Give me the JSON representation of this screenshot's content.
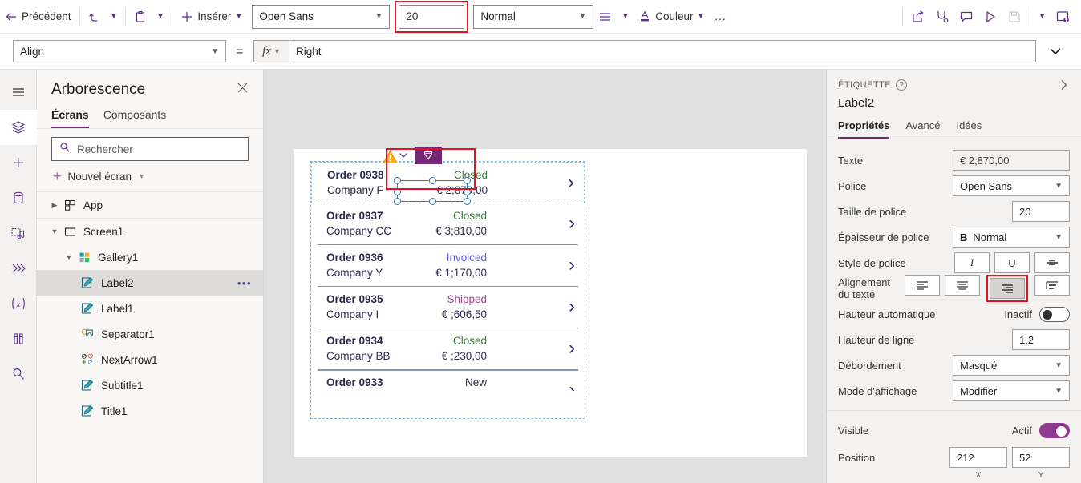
{
  "commandbar": {
    "back": "Précédent",
    "insert": "Insérer",
    "color": "Couleur",
    "more": "…",
    "font_name": "Open Sans",
    "font_size": "20",
    "font_weight": "Normal",
    "icons": {
      "back_arrow": "back-arrow-icon",
      "undo": "undo-icon",
      "paste": "paste-icon",
      "plus": "plus-icon",
      "align_lines": "align-lines-icon",
      "font_color": "font-color-icon",
      "share": "share-icon",
      "checker": "app-checker-icon",
      "comment": "comment-icon",
      "play": "play-preview-icon",
      "save": "save-icon",
      "publish": "publish-icon"
    }
  },
  "formulabar": {
    "property": "Align",
    "equals": "=",
    "fx": "fx",
    "formula": "Right"
  },
  "tree": {
    "title": "Arborescence",
    "tabs": [
      {
        "label": "Écrans",
        "selected": true
      },
      {
        "label": "Composants",
        "selected": false
      }
    ],
    "search_placeholder": "Rechercher",
    "new_screen": "Nouvel écran",
    "items": [
      {
        "label": "App",
        "indent": 0,
        "chev": "right",
        "icon": "app-grid-icon",
        "selected": false,
        "menu": false
      },
      {
        "label": "Screen1",
        "indent": 0,
        "chev": "down",
        "icon": "screen-icon",
        "selected": false,
        "menu": false
      },
      {
        "label": "Gallery1",
        "indent": 1,
        "chev": "down",
        "icon": "gallery-icon",
        "selected": false,
        "menu": false
      },
      {
        "label": "Label2",
        "indent": 2,
        "chev": "none",
        "icon": "label-icon",
        "selected": true,
        "menu": true
      },
      {
        "label": "Label1",
        "indent": 2,
        "chev": "none",
        "icon": "label-icon",
        "selected": false,
        "menu": false
      },
      {
        "label": "Separator1",
        "indent": 2,
        "chev": "none",
        "icon": "separator-icon",
        "selected": false,
        "menu": false
      },
      {
        "label": "NextArrow1",
        "indent": 2,
        "chev": "none",
        "icon": "nextarrow-icon",
        "selected": false,
        "menu": false
      },
      {
        "label": "Subtitle1",
        "indent": 2,
        "chev": "none",
        "icon": "label-icon",
        "selected": false,
        "menu": false
      },
      {
        "label": "Title1",
        "indent": 2,
        "chev": "none",
        "icon": "label-icon",
        "selected": false,
        "menu": false
      }
    ]
  },
  "canvas": {
    "gallery_rows": [
      {
        "title": "Order 0938",
        "company": "Company F",
        "status": "Closed",
        "status_color": "#3a7a3a",
        "amount": "€ 2;870,00",
        "selected": true,
        "divider": false,
        "arrow": true
      },
      {
        "title": "Order 0937",
        "company": "Company CC",
        "status": "Closed",
        "status_color": "#3a7a3a",
        "amount": "€ 3;810,00",
        "selected": false,
        "divider": true,
        "arrow": true
      },
      {
        "title": "Order 0936",
        "company": "Company Y",
        "status": "Invoiced",
        "status_color": "#5b5bd6",
        "amount": "€ 1;170,00",
        "selected": false,
        "divider": true,
        "arrow": true
      },
      {
        "title": "Order 0935",
        "company": "Company I",
        "status": "Shipped",
        "status_color": "#a6449a",
        "amount": "€ ;606,50",
        "selected": false,
        "divider": true,
        "arrow": true
      },
      {
        "title": "Order 0934",
        "company": "Company BB",
        "status": "Closed",
        "status_color": "#3a7a3a",
        "amount": "€ ;230,00",
        "selected": false,
        "divider": true,
        "arrow": true
      },
      {
        "title": "Order 0933",
        "company": "",
        "status": "New",
        "status_color": "#2b2b50",
        "amount": "",
        "selected": false,
        "divider": true,
        "arrow": true
      }
    ],
    "selection": {
      "warning_icon": "warning-triangle-icon",
      "badge_icon": "label-widget-icon",
      "highlight_color": "#e81123",
      "handle_color": "#2b7cc4"
    }
  },
  "properties": {
    "kind": "ÉTIQUETTE",
    "name": "Label2",
    "tabs": [
      {
        "label": "Propriétés",
        "selected": true
      },
      {
        "label": "Avancé",
        "selected": false
      },
      {
        "label": "Idées",
        "selected": false
      }
    ],
    "rows": {
      "text_label": "Texte",
      "text_value": "€ 2;870,00",
      "font_label": "Police",
      "font_value": "Open Sans",
      "fontsize_label": "Taille de police",
      "fontsize_value": "20",
      "fontweight_label": "Épaisseur de police",
      "fontweight_value": "Normal",
      "fontweight_prefix": "B",
      "fontstyle_label": "Style de police",
      "fontstyle_italic": "I",
      "fontstyle_underline": "U",
      "fontstyle_strike": "S",
      "align_label": "Alignement du texte",
      "autoheight_label": "Hauteur automatique",
      "autoheight_value": "Inactif",
      "lineheight_label": "Hauteur de ligne",
      "lineheight_value": "1,2",
      "overflow_label": "Débordement",
      "overflow_value": "Masqué",
      "displaymode_label": "Mode d'affichage",
      "displaymode_value": "Modifier",
      "visible_label": "Visible",
      "visible_value": "Actif",
      "position_label": "Position",
      "position_x": "212",
      "position_y": "52",
      "axis_x": "X",
      "axis_y": "Y"
    }
  },
  "colors": {
    "accent": "#742774",
    "brand_purple": "#5c2d91",
    "highlight_red": "#e81123",
    "toggle_on": "#8e3a8e"
  }
}
